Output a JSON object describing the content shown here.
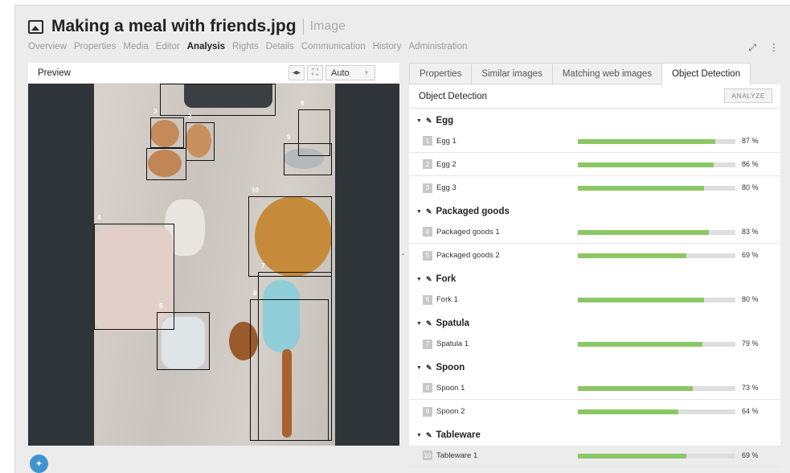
{
  "header": {
    "title": "Making a meal with friends.jpg",
    "subtitle": "Image",
    "nav": [
      "Overview",
      "Properties",
      "Media",
      "Editor",
      "Analysis",
      "Rights",
      "Details",
      "Communication",
      "History",
      "Administration"
    ],
    "active_nav": "Analysis",
    "tools": {
      "expand_icon": "⤢",
      "more_icon": "⋮"
    }
  },
  "preview": {
    "label": "Preview",
    "arrows_icon": "◂▸",
    "fullscreen_icon": "⛶",
    "zoom_value": "Auto",
    "box_labels": [
      "3",
      "2",
      "6",
      "9",
      "10",
      "4",
      "7",
      "8",
      "5"
    ]
  },
  "panel": {
    "tabs": [
      "Properties",
      "Similar images",
      "Matching web images",
      "Object Detection"
    ],
    "active_tab": "Object Detection",
    "section_title": "Object Detection",
    "analyze_label": "ANALYZE",
    "categories": [
      {
        "name": "Egg",
        "items": [
          {
            "index": "1",
            "label": "Egg 1",
            "percent_text": "87 %",
            "value": 87
          },
          {
            "index": "2",
            "label": "Egg 2",
            "percent_text": "86 %",
            "value": 86
          },
          {
            "index": "3",
            "label": "Egg 3",
            "percent_text": "80 %",
            "value": 80
          }
        ]
      },
      {
        "name": "Packaged goods",
        "items": [
          {
            "index": "4",
            "label": "Packaged goods 1",
            "percent_text": "83 %",
            "value": 83
          },
          {
            "index": "5",
            "label": "Packaged goods 2",
            "percent_text": "69 %",
            "value": 69
          }
        ]
      },
      {
        "name": "Fork",
        "items": [
          {
            "index": "6",
            "label": "Fork 1",
            "percent_text": "80 %",
            "value": 80
          }
        ]
      },
      {
        "name": "Spatula",
        "items": [
          {
            "index": "7",
            "label": "Spatula 1",
            "percent_text": "79 %",
            "value": 79
          }
        ]
      },
      {
        "name": "Spoon",
        "items": [
          {
            "index": "8",
            "label": "Spoon 1",
            "percent_text": "73 %",
            "value": 73
          },
          {
            "index": "9",
            "label": "Spoon 2",
            "percent_text": "64 %",
            "value": 64
          }
        ]
      },
      {
        "name": "Tableware",
        "items": [
          {
            "index": "10",
            "label": "Tableware 1",
            "percent_text": "69 %",
            "value": 69
          }
        ]
      }
    ]
  },
  "colors": {
    "bar_fill": "#8cc665",
    "bar_track": "#dedede",
    "pin": "#3f94cf"
  },
  "footer": {
    "pin_icon": "pin-icon"
  }
}
